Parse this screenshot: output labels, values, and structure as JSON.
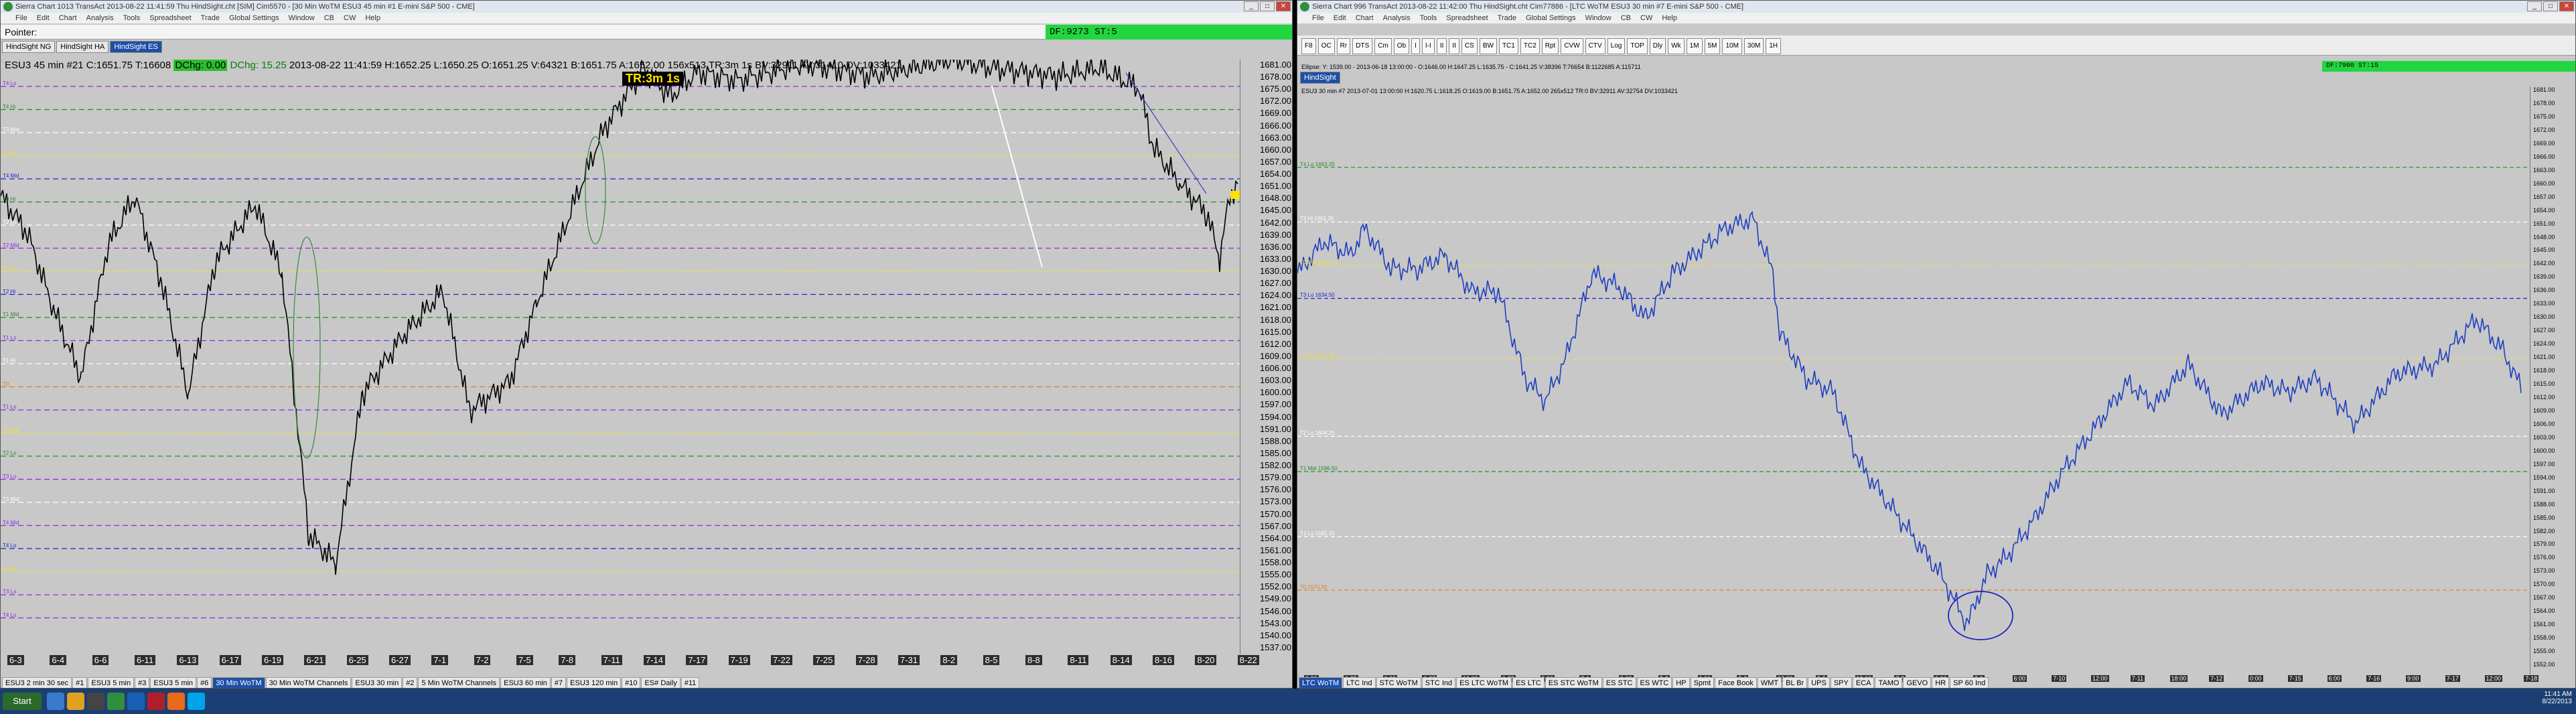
{
  "left": {
    "title": "Sierra Chart 1013 TransAct 2013-08-22 11:41:59 Thu HindSight.cht [SIM] Cim5570 - [30 Min WoTM ESU3 45 min #1 E-mini S&P 500 - CME]",
    "menu": [
      "File",
      "Edit",
      "Chart",
      "Analysis",
      "Tools",
      "Spreadsheet",
      "Trade",
      "Global Settings",
      "Window",
      "CB",
      "CW",
      "Help"
    ],
    "pointer_label": "Pointer:",
    "df_label": "DF:9273  ST:5",
    "tabs": [
      "HindSight NG",
      "HindSight HA",
      "HindSight ES"
    ],
    "header": "ESU3 45 min  #21 C:1651.75 T:16608",
    "header_dchg_box": "DChg: 0.00",
    "header_dchg": "DChg: 15.25",
    "header_rest": "2013-08-22  11:41:59  H:1652.25  L:1650.25  O:1651.25  V:64321  B:1651.75  A:1652.00  156x513  TR:3m 1s  BV:32911  AV:31410  DV:1033421",
    "tr_box": "TR:3m 1s",
    "series_labels": [
      "45 min",
      "#21 ESU3",
      "45 min",
      "#21 ESU3",
      "45 min",
      "#21 ESU3"
    ],
    "ticks": [
      "1681.00",
      "1678.00",
      "1675.00",
      "1672.00",
      "1669.00",
      "1666.00",
      "1663.00",
      "1660.00",
      "1657.00",
      "1654.00",
      "1651.00",
      "1648.00",
      "1645.00",
      "1642.00",
      "1639.00",
      "1636.00",
      "1633.00",
      "1630.00",
      "1627.00",
      "1624.00",
      "1621.00",
      "1618.00",
      "1615.00",
      "1612.00",
      "1609.00",
      "1606.00",
      "1603.00",
      "1600.00",
      "1597.00",
      "1594.00",
      "1591.00",
      "1588.00",
      "1585.00",
      "1582.00",
      "1579.00",
      "1576.00",
      "1573.00",
      "1570.00",
      "1567.00",
      "1564.00",
      "1561.00",
      "1558.00",
      "1555.00",
      "1552.00",
      "1549.00",
      "1546.00",
      "1543.00",
      "1540.00",
      "1537.00"
    ],
    "dates": [
      "6-3",
      "6-4",
      "6-6",
      "6-11",
      "6-13",
      "6-17",
      "6-19",
      "6-21",
      "6-25",
      "6-27",
      "7-1",
      "7-2",
      "7-5",
      "7-8",
      "7-11",
      "7-14",
      "7-17",
      "7-19",
      "7-22",
      "7-25",
      "7-28",
      "7-31",
      "8-2",
      "8-5",
      "8-8",
      "8-11",
      "8-14",
      "8-16",
      "8-20",
      "8-22"
    ],
    "level_labels": [
      "T4 Lo",
      "T4 Hi",
      "T3 Mid",
      "T3 Lo",
      "T4 Mid",
      "T3 Hi",
      "T2 Lo",
      "T2 Mid",
      "T3 Lo",
      "T2 Hi",
      "T1 Mid",
      "T1 Lo",
      "T1 Hi",
      "T0",
      "T1 Lo",
      "T2 Mid",
      "T2 Lo",
      "T3 Lo",
      "T3 Mid",
      "T4 Mid",
      "T4 Lo",
      "T4 Hi",
      "T3 Lo",
      "T4 Lo"
    ],
    "bottom_tabs": [
      "ESU3 2 min 30 sec",
      "#1",
      "ESU3 5 min",
      "#3",
      "ESU3 5 min",
      "#6",
      "30 Min WoTM",
      "30 Min WoTM Channels",
      "ESU3 30 min",
      "#2",
      "5 Min WoTM Channels",
      "ESU3 60 min",
      "#7",
      "ESU3 120 min",
      "#10",
      "ES# Daily",
      "#11"
    ],
    "bottom_active": "30 Min WoTM"
  },
  "right": {
    "title": "Sierra Chart 996 TransAct 2013-08-22 11:42:00 Thu HindSight.cht Cim77886 - [LTC WoTM ESU3 30 min #7 E-mini S&P 500 - CME]",
    "menu": [
      "File",
      "Edit",
      "Chart",
      "Analysis",
      "Tools",
      "Spreadsheet",
      "Trade",
      "Global Settings",
      "Window",
      "CB",
      "CW",
      "Help"
    ],
    "toolbar": [
      "F8",
      "OC",
      "Rr",
      "DTS",
      "Cm",
      "Ob",
      "I",
      "I-I",
      "II",
      "II",
      "CS",
      "BW",
      "TC1",
      "TC2",
      "Rpt",
      "CVW",
      "CTV",
      "Log",
      "TOP",
      "Dly",
      "Wk",
      "1M",
      "5M",
      "10M",
      "30M",
      "1H"
    ],
    "tab": "HindSight",
    "ellipse_line": "Ellipse: Y: 1539.00 - 2013-06-18 13:00:00 - O:1646.00  H:1647.25  L:1635.75 - C:1641.25  V:38396  T:76654  B:1122685  A:115711",
    "df_label": "DF:7900  ST:15",
    "header": "ESU3 30 min  #7  2013-07-01  13:00:00  H:1620.75  L:1618.25  O:1619.00  B:1651.75  A:1652.00  265x512  TR:0  BV:32911  AV:32754  DV:1033421",
    "ticks": [
      "1681.00",
      "1678.00",
      "1675.00",
      "1672.00",
      "1669.00",
      "1666.00",
      "1663.00",
      "1660.00",
      "1657.00",
      "1654.00",
      "1651.00",
      "1648.00",
      "1645.00",
      "1642.00",
      "1639.00",
      "1636.00",
      "1633.00",
      "1630.00",
      "1627.00",
      "1624.00",
      "1621.00",
      "1618.00",
      "1615.00",
      "1612.00",
      "1609.00",
      "1606.00",
      "1603.00",
      "1600.00",
      "1597.00",
      "1594.00",
      "1591.00",
      "1588.00",
      "1585.00",
      "1582.00",
      "1579.00",
      "1576.00",
      "1573.00",
      "1570.00",
      "1567.00",
      "1564.00",
      "1561.00",
      "1558.00",
      "1555.00",
      "1552.00"
    ],
    "dates": [
      "0:00",
      "6-25",
      "6:00",
      "6-27",
      "12:00",
      "6-28",
      "3:00",
      "7-1",
      "9:00",
      "7-2",
      "6:00",
      "7-3",
      "12:00",
      "7-5",
      "18:00",
      "7-8",
      "0:00",
      "7-9",
      "6:00",
      "7-10",
      "12:00",
      "7-11",
      "18:00",
      "7-12",
      "0:00",
      "7-15",
      "6:00",
      "7-16",
      "9:00",
      "7-17",
      "12:00",
      "7-18"
    ],
    "level_labels": [
      "T4 Lo 1663.25",
      "T3 Hi 1651.25",
      "T3 Mid 1641.75",
      "T3 Lo 1634.50",
      "T2 Hi 1621.25",
      "T2 Lo 1604.25",
      "T1 Mid 1596.50",
      "T1 Lo 1582.25",
      "T0 1570.50"
    ],
    "bottom_tabs": [
      "LTC WoTM",
      "LTC Ind",
      "STC WoTM",
      "STC Ind",
      "ES LTC WoTM",
      "ES LTC",
      "ES STC WoTM",
      "ES STC",
      "ES WTC",
      "HP",
      "Spmt",
      "Face Book",
      "WMT",
      "BL Br",
      "UPS",
      "SPY",
      "ECA",
      "TAMO",
      "GEVO",
      "HR",
      "SP 60 Ind"
    ],
    "bottom_active": "LTC WoTM"
  },
  "taskbar": {
    "start_label": "Start",
    "clock_time": "11:41 AM",
    "clock_date": "8/22/2013"
  },
  "colors": {
    "chart_bg": "#c8c8c8",
    "price_line_left": "#000000",
    "price_line_right": "#1f3fbf",
    "df_green": "#21d63f",
    "level_green": "#2a8a2a",
    "level_yellow": "#f0e040",
    "level_purple": "#8a2be2",
    "level_blue": "#2222cc",
    "level_orange": "#e08020",
    "level_white": "#ffffff"
  }
}
